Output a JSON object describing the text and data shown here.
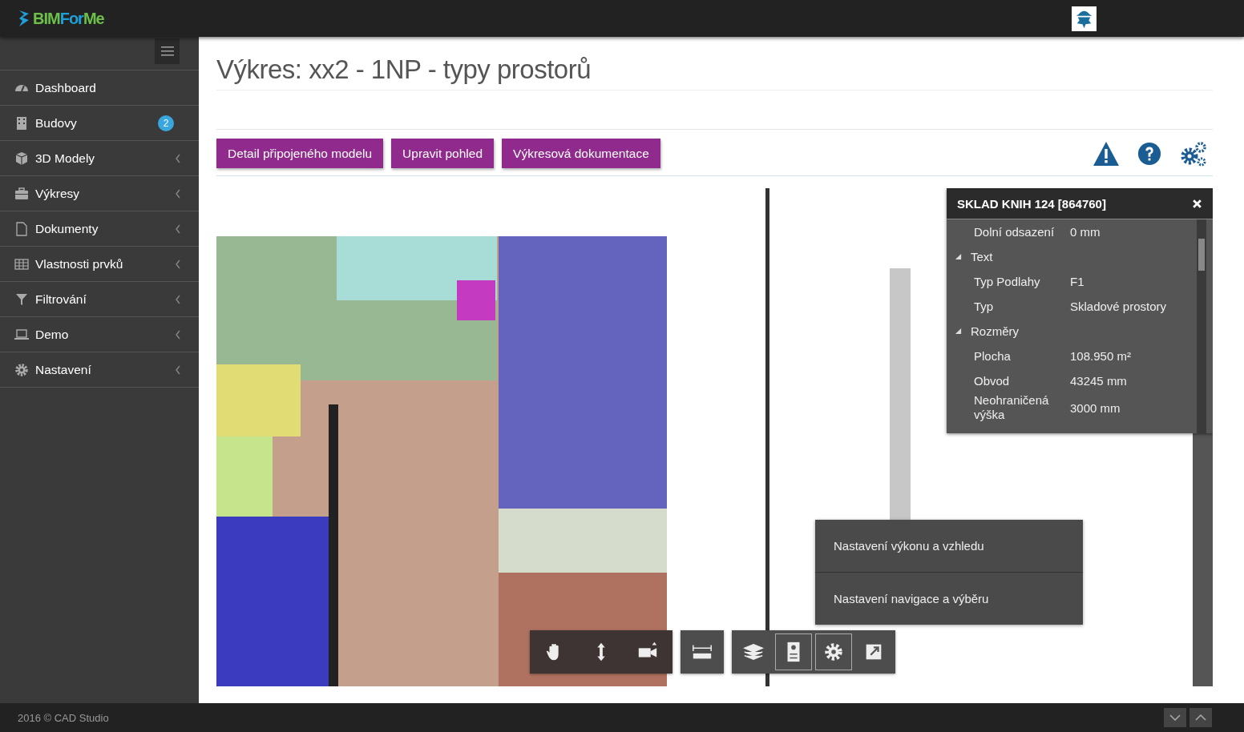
{
  "logo": {
    "parts": [
      {
        "text": "BIM",
        "color": "#6cc04a"
      },
      {
        "text": "For",
        "color": "#1e9fd8"
      },
      {
        "text": "Me",
        "color": "#6cc04a"
      }
    ]
  },
  "sidebar": {
    "items": [
      {
        "label": "Dashboard",
        "expandable": false
      },
      {
        "label": "Budovy",
        "expandable": false,
        "badge": "2"
      },
      {
        "label": "3D Modely",
        "expandable": true
      },
      {
        "label": "Výkresy",
        "expandable": true
      },
      {
        "label": "Dokumenty",
        "expandable": true
      },
      {
        "label": "Vlastnosti prvků",
        "expandable": true
      },
      {
        "label": "Filtrování",
        "expandable": true
      },
      {
        "label": "Demo",
        "expandable": true
      },
      {
        "label": "Nastavení",
        "expandable": true
      }
    ]
  },
  "page": {
    "title": "Výkres: xx2 - 1NP - typy prostorů",
    "buttons": [
      "Detail připojeného modelu",
      "Upravit pohled",
      "Výkresová dokumentace"
    ]
  },
  "viewer": {
    "kind": "picture",
    "properties": {
      "title": "SKLAD KNIH 124 [864760]",
      "rows": [
        {
          "kind": "row",
          "label": "Dolní odsazení",
          "value": "0 mm"
        },
        {
          "kind": "group",
          "label": "Text",
          "expanded": true
        },
        {
          "kind": "row",
          "label": "Typ Podlahy",
          "value": "F1"
        },
        {
          "kind": "row",
          "label": "Typ",
          "value": "Skladové prostory"
        },
        {
          "kind": "group",
          "label": "Rozměry",
          "expanded": true
        },
        {
          "kind": "row",
          "label": "Plocha",
          "value": "108.950 m²"
        },
        {
          "kind": "row",
          "label": "Obvod",
          "value": "43245 mm"
        },
        {
          "kind": "row",
          "label": "Neohraničená výška",
          "value": "3000 mm"
        }
      ]
    },
    "settings_menu": [
      "Nastavení výkonu a vzhledu",
      "Nastavení navigace a výběru"
    ],
    "toolbars": [
      [
        {
          "selected": false
        },
        {
          "selected": false
        },
        {
          "selected": false
        }
      ],
      [
        {
          "selected": false
        }
      ],
      [
        {
          "selected": false
        },
        {
          "selected": true
        },
        {
          "selected": true
        },
        {
          "selected": false
        }
      ]
    ]
  },
  "footer": {
    "text": "2016 © CAD Studio"
  }
}
